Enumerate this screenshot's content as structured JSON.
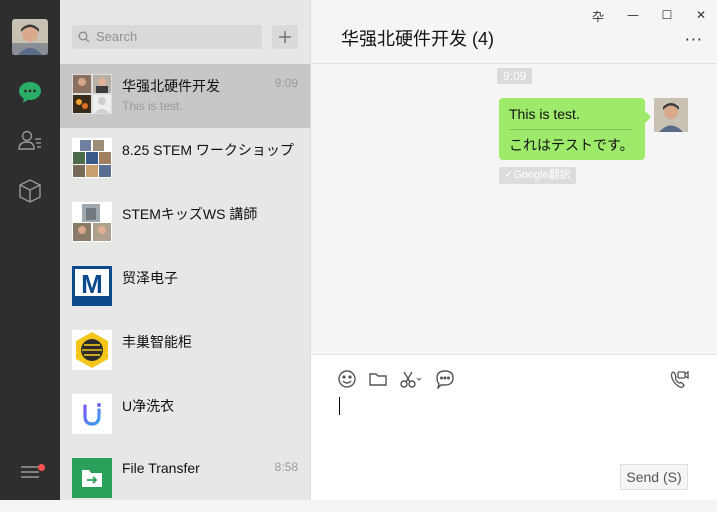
{
  "sidebar": {
    "icons": [
      "user-avatar",
      "chat-bubble-icon",
      "contacts-icon",
      "cube-icon",
      "menu-icon"
    ],
    "accent": "#2aae67",
    "badge_color": "#fa5151"
  },
  "search": {
    "placeholder": "Search"
  },
  "conversations": [
    {
      "name": "华强北硬件开发",
      "time": "9:09",
      "preview": "This is test.",
      "active": true
    },
    {
      "name": "8.25 STEM ワークショップ",
      "time": "",
      "preview": ""
    },
    {
      "name": "STEMキッズWS 講師",
      "time": "",
      "preview": ""
    },
    {
      "name": "贸泽电子",
      "time": "",
      "preview": ""
    },
    {
      "name": "丰巢智能柜",
      "time": "",
      "preview": ""
    },
    {
      "name": "U净洗衣",
      "time": "",
      "preview": ""
    },
    {
      "name": "File Transfer",
      "time": "8:58",
      "preview": ""
    }
  ],
  "window_controls": [
    "卆",
    "—",
    "☐",
    "✕"
  ],
  "chat": {
    "title": "华强北硬件开发 (4)",
    "more": "···",
    "time_label": "9:09",
    "message": {
      "text": "This is test.",
      "translation": "これはテストです。"
    },
    "translate_tag": "✓Google翻訳",
    "bubble_color": "#9eea6a"
  },
  "composer": {
    "send_label": "Send (S)"
  }
}
